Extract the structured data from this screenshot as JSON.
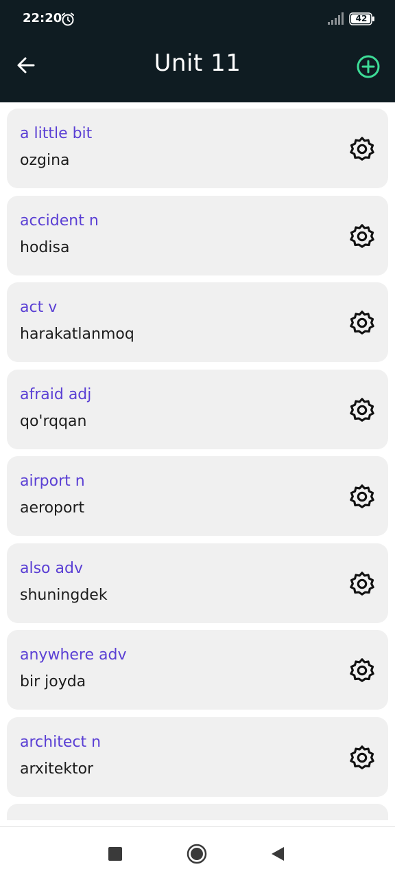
{
  "status_bar": {
    "time": "22:20",
    "battery": "42",
    "icons": [
      "alarm-icon",
      "signal-icon",
      "battery-icon"
    ]
  },
  "app_bar": {
    "title": "Unit 11",
    "back_icon": "arrow-left-icon",
    "add_icon": "plus-circle-icon",
    "accent_color": "#3ddc97",
    "background_color": "#0f1c22"
  },
  "words": [
    {
      "word": "a little bit",
      "translation": "ozgina"
    },
    {
      "word": "accident n",
      "translation": "hodisa"
    },
    {
      "word": "act v",
      "translation": "harakatlanmoq"
    },
    {
      "word": "afraid adj",
      "translation": "qo'rqqan"
    },
    {
      "word": "airport n",
      "translation": "aeroport"
    },
    {
      "word": "also adv",
      "translation": "shuningdek"
    },
    {
      "word": "anywhere adv",
      "translation": "bir joyda"
    },
    {
      "word": "architect n",
      "translation": "arxitektor"
    }
  ],
  "colors": {
    "word": "#5a3fd4",
    "translation": "#1d1d1d",
    "card": "#f0f0f0"
  },
  "nav_bar": {
    "icons": [
      "recents-square-icon",
      "home-circle-icon",
      "back-triangle-icon"
    ]
  }
}
